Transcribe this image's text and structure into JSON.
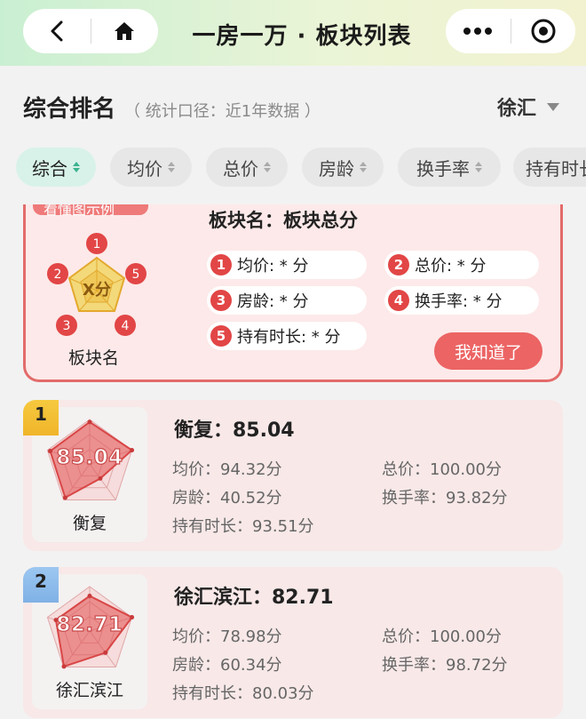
{
  "window": {
    "title": "一房一万 · 板块列表"
  },
  "icons": {
    "back": "back-chevron-icon",
    "home": "home-icon",
    "more": "more-dots-icon",
    "close": "target-circle-icon"
  },
  "ranking": {
    "heading": "综合排名",
    "scope": "（ 统计口径：近1年数据 ）",
    "region": "徐汇"
  },
  "filters": [
    "综合",
    "均价",
    "总价",
    "房龄",
    "换手率",
    "持有时长"
  ],
  "legend": {
    "tab_label": "看懂图示例",
    "center_label": "X分",
    "name": "板块名",
    "title": "板块名：板块总分",
    "items": [
      {
        "num": "1",
        "text": "均价: * 分"
      },
      {
        "num": "2",
        "text": "总价: * 分"
      },
      {
        "num": "3",
        "text": "房龄: * 分"
      },
      {
        "num": "4",
        "text": "换手率: * 分"
      },
      {
        "num": "5",
        "text": "持有时长: * 分"
      }
    ],
    "button": "我知道了"
  },
  "cards": [
    {
      "rank": "1",
      "name": "衡复",
      "score": "85.04",
      "title": "衡复：85.04",
      "scores": [
        94.32,
        100.0,
        40.52,
        93.82,
        93.51
      ],
      "metrics": [
        "均价：94.32分",
        "总价：100.00分",
        "房龄：40.52分",
        "换手率：93.82分",
        "持有时长：93.51分"
      ]
    },
    {
      "rank": "2",
      "name": "徐汇滨江",
      "score": "82.71",
      "title": "徐汇滨江：82.71",
      "scores": [
        78.98,
        100.0,
        60.34,
        98.72,
        80.03
      ],
      "metrics": [
        "均价：78.98分",
        "总价：100.00分",
        "房龄：60.34分",
        "换手率：98.72分",
        "持有时长：80.03分"
      ]
    }
  ],
  "colors": {
    "accent": "#e24646",
    "active_chip": "#d8f2ea",
    "card_bg": "#f8e8e8"
  }
}
